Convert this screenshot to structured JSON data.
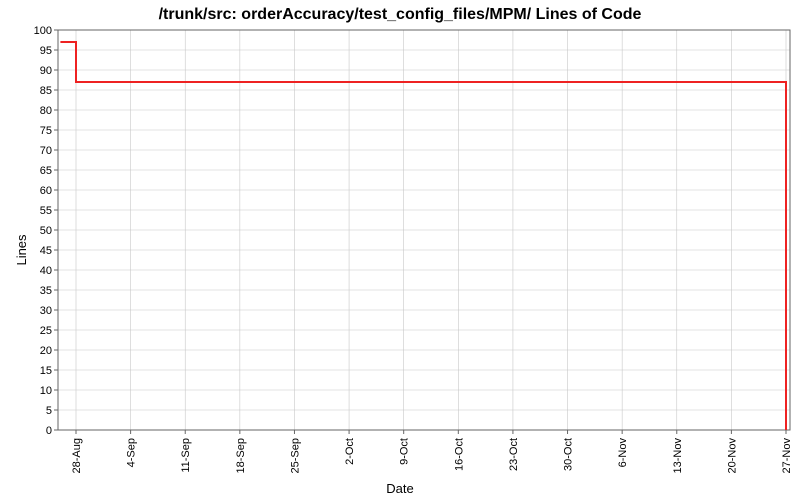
{
  "chart_data": {
    "type": "line",
    "title": "/trunk/src: orderAccuracy/test_config_files/MPM/ Lines of Code",
    "xlabel": "Date",
    "ylabel": "Lines",
    "ylim": [
      0,
      100
    ],
    "y_ticks": [
      0,
      5,
      10,
      15,
      20,
      25,
      30,
      35,
      40,
      45,
      50,
      55,
      60,
      65,
      70,
      75,
      80,
      85,
      90,
      95,
      100
    ],
    "x_categories": [
      "28-Aug",
      "4-Sep",
      "11-Sep",
      "18-Sep",
      "25-Sep",
      "2-Oct",
      "9-Oct",
      "16-Oct",
      "23-Oct",
      "30-Oct",
      "6-Nov",
      "13-Nov",
      "20-Nov",
      "27-Nov"
    ],
    "series": [
      {
        "name": "Lines of Code",
        "color": "#ee2222",
        "points": [
          {
            "x": "26-Aug",
            "y": 97
          },
          {
            "x": "28-Aug",
            "y": 97
          },
          {
            "x": "28-Aug",
            "y": 87
          },
          {
            "x": "27-Nov",
            "y": 87
          },
          {
            "x": "27-Nov",
            "y": 0
          }
        ]
      }
    ]
  }
}
